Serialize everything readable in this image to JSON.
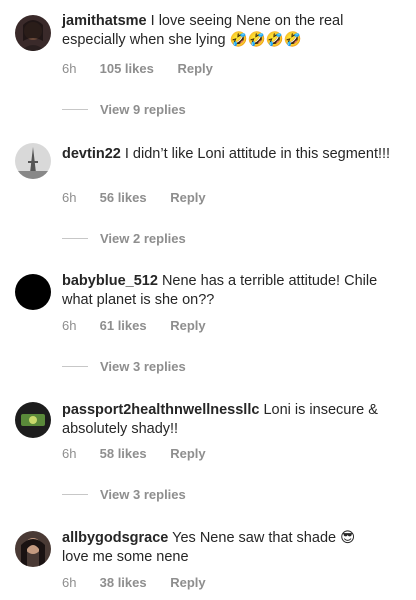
{
  "comments": [
    {
      "avatar": "avatar-woman-dark-hair",
      "username": "jamithatsme",
      "text": "I love seeing Nene on the real especially when she lying",
      "emoji": "🤣🤣🤣🤣",
      "time": "6h",
      "likes": "105 likes",
      "reply": "Reply",
      "view_replies": "View 9 replies"
    },
    {
      "avatar": "avatar-eiffel-tower",
      "username": "devtin22",
      "text": "I didn’t like Loni attitude in this segment!!!",
      "emoji": "",
      "time": "6h",
      "likes": "56 likes",
      "reply": "Reply",
      "view_replies": "View 2 replies"
    },
    {
      "avatar": "avatar-black",
      "username": "babyblue_512",
      "text": "Nene has a terrible attitude! Chile what planet is she on??",
      "emoji": "",
      "time": "6h",
      "likes": "61 likes",
      "reply": "Reply",
      "view_replies": "View 3 replies"
    },
    {
      "avatar": "avatar-logo-green",
      "username": "passport2healthnwellnessllc",
      "text": "Loni is insecure & absolutely shady!!",
      "emoji": "",
      "time": "6h",
      "likes": "58 likes",
      "reply": "Reply",
      "view_replies": "View 3 replies"
    },
    {
      "avatar": "avatar-woman-long-hair",
      "username": "allbygodsgrace",
      "text": "Yes Nene saw that shade",
      "text2": "love me some nene",
      "emoji": "😎",
      "time": "6h",
      "likes": "38 likes",
      "reply": "Reply"
    }
  ]
}
